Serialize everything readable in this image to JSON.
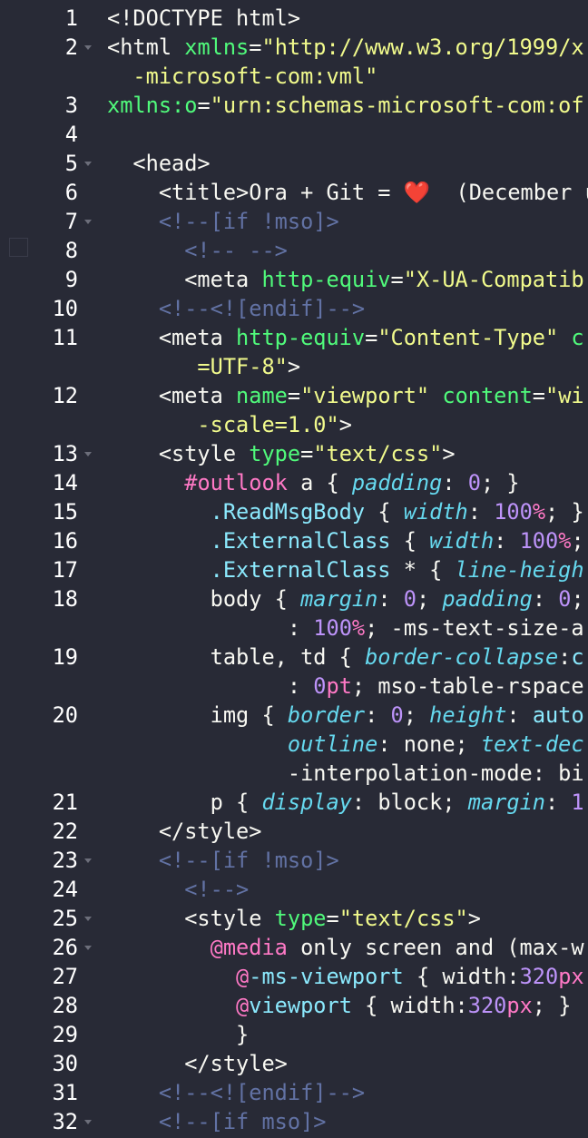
{
  "editor": {
    "language": "html",
    "theme": "dark",
    "colors": {
      "background": "#282a36",
      "line_number": "#ffffff",
      "fold_arrow": "#6c6e7a",
      "plain": "#f8f8f2",
      "attribute": "#50fa7b",
      "string": "#f1fa8c",
      "comment": "#6272a4",
      "selector_id": "#ff79c6",
      "selector_class": "#8be9fd",
      "property": "#66d9ef",
      "number": "#bd93f9",
      "emoji_heart": "#ff5555"
    },
    "rows": [
      {
        "num": "1",
        "fold": false,
        "tokens": [
          [
            "p",
            "<!DOCTYPE html>"
          ]
        ]
      },
      {
        "num": "2",
        "fold": true,
        "tokens": [
          [
            "p",
            "<html "
          ],
          [
            "a",
            "xmlns"
          ],
          [
            "p",
            "="
          ],
          [
            "s",
            "\"http://www.w3.org/1999/x"
          ]
        ]
      },
      {
        "num": "",
        "fold": false,
        "tokens": [
          [
            "s",
            "  -microsoft-com:vml\""
          ]
        ]
      },
      {
        "num": "3",
        "fold": false,
        "tokens": [
          [
            "a",
            "xmlns:o"
          ],
          [
            "p",
            "="
          ],
          [
            "s",
            "\"urn:schemas-microsoft-com:of"
          ]
        ]
      },
      {
        "num": "4",
        "fold": false,
        "tokens": []
      },
      {
        "num": "5",
        "fold": true,
        "tokens": [
          [
            "p",
            "  <head>"
          ]
        ]
      },
      {
        "num": "6",
        "fold": false,
        "tokens": [
          [
            "p",
            "    <title>Ora + Git = "
          ],
          [
            "e",
            "❤️"
          ],
          [
            "p",
            "  (December u"
          ]
        ]
      },
      {
        "num": "7",
        "fold": true,
        "tokens": [
          [
            "c",
            "    <!--[if !mso]>"
          ]
        ]
      },
      {
        "num": "8",
        "fold": false,
        "tokens": [
          [
            "c",
            "      <!-- -->"
          ]
        ]
      },
      {
        "num": "9",
        "fold": false,
        "tokens": [
          [
            "p",
            "      <meta "
          ],
          [
            "a",
            "http-equiv"
          ],
          [
            "p",
            "="
          ],
          [
            "s",
            "\"X-UA-Compatib"
          ]
        ]
      },
      {
        "num": "10",
        "fold": false,
        "tokens": [
          [
            "c",
            "    <!--<![endif]-->"
          ]
        ]
      },
      {
        "num": "11",
        "fold": false,
        "tokens": [
          [
            "p",
            "    <meta "
          ],
          [
            "a",
            "http-equiv"
          ],
          [
            "p",
            "="
          ],
          [
            "s",
            "\"Content-Type\""
          ],
          [
            "p",
            " "
          ],
          [
            "a",
            "c"
          ]
        ]
      },
      {
        "num": "",
        "fold": false,
        "tokens": [
          [
            "s",
            "       =UTF-8\""
          ],
          [
            "p",
            ">"
          ]
        ]
      },
      {
        "num": "12",
        "fold": false,
        "tokens": [
          [
            "p",
            "    <meta "
          ],
          [
            "a",
            "name"
          ],
          [
            "p",
            "="
          ],
          [
            "s",
            "\"viewport\""
          ],
          [
            "p",
            " "
          ],
          [
            "a",
            "content"
          ],
          [
            "p",
            "="
          ],
          [
            "s",
            "\"wi"
          ]
        ]
      },
      {
        "num": "",
        "fold": false,
        "tokens": [
          [
            "s",
            "       -scale=1.0\""
          ],
          [
            "p",
            ">"
          ]
        ]
      },
      {
        "num": "13",
        "fold": true,
        "tokens": [
          [
            "p",
            "    <style "
          ],
          [
            "a",
            "type"
          ],
          [
            "p",
            "="
          ],
          [
            "s",
            "\"text/css\""
          ],
          [
            "p",
            ">"
          ]
        ]
      },
      {
        "num": "14",
        "fold": false,
        "tokens": [
          [
            "p",
            "      "
          ],
          [
            "k",
            "#outlook"
          ],
          [
            "p",
            " a { "
          ],
          [
            "i",
            "padding"
          ],
          [
            "p",
            ": "
          ],
          [
            "n",
            "0"
          ],
          [
            "p",
            "; }"
          ]
        ]
      },
      {
        "num": "15",
        "fold": false,
        "tokens": [
          [
            "p",
            "        "
          ],
          [
            "x",
            ".ReadMsgBody"
          ],
          [
            "p",
            " { "
          ],
          [
            "i",
            "width"
          ],
          [
            "p",
            ": "
          ],
          [
            "n",
            "100"
          ],
          [
            "k",
            "%"
          ],
          [
            "p",
            "; }"
          ]
        ]
      },
      {
        "num": "16",
        "fold": false,
        "tokens": [
          [
            "p",
            "        "
          ],
          [
            "x",
            ".ExternalClass"
          ],
          [
            "p",
            " { "
          ],
          [
            "i",
            "width"
          ],
          [
            "p",
            ": "
          ],
          [
            "n",
            "100"
          ],
          [
            "k",
            "%"
          ],
          [
            "p",
            ";"
          ]
        ]
      },
      {
        "num": "17",
        "fold": false,
        "tokens": [
          [
            "p",
            "        "
          ],
          [
            "x",
            ".ExternalClass"
          ],
          [
            "p",
            " * { "
          ],
          [
            "i",
            "line-heigh"
          ]
        ]
      },
      {
        "num": "18",
        "fold": false,
        "tokens": [
          [
            "p",
            "        body { "
          ],
          [
            "i",
            "margin"
          ],
          [
            "p",
            ": "
          ],
          [
            "n",
            "0"
          ],
          [
            "p",
            "; "
          ],
          [
            "i",
            "padding"
          ],
          [
            "p",
            ": "
          ],
          [
            "n",
            "0"
          ],
          [
            "p",
            ";"
          ]
        ]
      },
      {
        "num": "",
        "fold": false,
        "tokens": [
          [
            "p",
            "              : "
          ],
          [
            "n",
            "100"
          ],
          [
            "k",
            "%"
          ],
          [
            "p",
            "; -ms-text-size-a"
          ]
        ]
      },
      {
        "num": "19",
        "fold": false,
        "tokens": [
          [
            "p",
            "        table, td { "
          ],
          [
            "i",
            "border-collapse"
          ],
          [
            "p",
            ":"
          ],
          [
            "x",
            "c"
          ]
        ]
      },
      {
        "num": "",
        "fold": false,
        "tokens": [
          [
            "p",
            "              : "
          ],
          [
            "n",
            "0"
          ],
          [
            "k",
            "pt"
          ],
          [
            "p",
            "; mso-table-rspace"
          ]
        ]
      },
      {
        "num": "20",
        "fold": false,
        "tokens": [
          [
            "p",
            "        img { "
          ],
          [
            "i",
            "border"
          ],
          [
            "p",
            ": "
          ],
          [
            "n",
            "0"
          ],
          [
            "p",
            "; "
          ],
          [
            "i",
            "height"
          ],
          [
            "p",
            ": "
          ],
          [
            "x",
            "auto"
          ]
        ]
      },
      {
        "num": "",
        "fold": false,
        "tokens": [
          [
            "p",
            "              "
          ],
          [
            "i",
            "outline"
          ],
          [
            "p",
            ": none; "
          ],
          [
            "i",
            "text-dec"
          ]
        ]
      },
      {
        "num": "",
        "fold": false,
        "tokens": [
          [
            "p",
            "              -interpolation-mode: bi"
          ]
        ]
      },
      {
        "num": "21",
        "fold": false,
        "tokens": [
          [
            "p",
            "        p { "
          ],
          [
            "i",
            "display"
          ],
          [
            "p",
            ": block; "
          ],
          [
            "i",
            "margin"
          ],
          [
            "p",
            ": "
          ],
          [
            "n",
            "1"
          ]
        ]
      },
      {
        "num": "22",
        "fold": false,
        "tokens": [
          [
            "p",
            "    </style>"
          ]
        ]
      },
      {
        "num": "23",
        "fold": true,
        "tokens": [
          [
            "c",
            "    <!--[if !mso]>"
          ]
        ]
      },
      {
        "num": "24",
        "fold": false,
        "tokens": [
          [
            "c",
            "      <!-->"
          ]
        ]
      },
      {
        "num": "25",
        "fold": true,
        "tokens": [
          [
            "p",
            "      <style "
          ],
          [
            "a",
            "type"
          ],
          [
            "p",
            "="
          ],
          [
            "s",
            "\"text/css\""
          ],
          [
            "p",
            ">"
          ]
        ]
      },
      {
        "num": "26",
        "fold": true,
        "tokens": [
          [
            "p",
            "        "
          ],
          [
            "k",
            "@media"
          ],
          [
            "p",
            " only screen and (max-w"
          ]
        ]
      },
      {
        "num": "27",
        "fold": false,
        "tokens": [
          [
            "p",
            "          "
          ],
          [
            "k",
            "@"
          ],
          [
            "x",
            "-ms-viewport"
          ],
          [
            "p",
            " { width:"
          ],
          [
            "n",
            "320"
          ],
          [
            "k",
            "px"
          ]
        ]
      },
      {
        "num": "28",
        "fold": false,
        "tokens": [
          [
            "p",
            "          "
          ],
          [
            "k",
            "@"
          ],
          [
            "x",
            "viewport"
          ],
          [
            "p",
            " { width:"
          ],
          [
            "n",
            "320"
          ],
          [
            "k",
            "px"
          ],
          [
            "p",
            "; }"
          ]
        ]
      },
      {
        "num": "29",
        "fold": false,
        "tokens": [
          [
            "p",
            "          }"
          ]
        ]
      },
      {
        "num": "30",
        "fold": false,
        "tokens": [
          [
            "p",
            "      </style>"
          ]
        ]
      },
      {
        "num": "31",
        "fold": false,
        "tokens": [
          [
            "c",
            "    <!--<![endif]-->"
          ]
        ]
      },
      {
        "num": "32",
        "fold": true,
        "tokens": [
          [
            "c",
            "    <!--[if mso]>"
          ]
        ]
      }
    ]
  }
}
